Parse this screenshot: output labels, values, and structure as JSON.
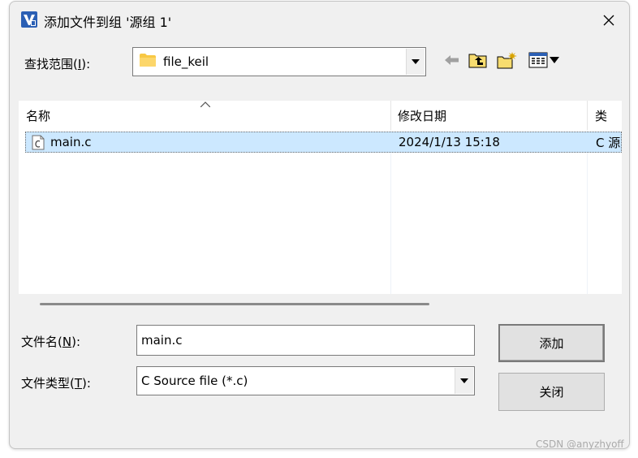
{
  "title": "添加文件到组 '源组 1'",
  "lookin": {
    "label_prefix": "查找范围(",
    "label_key": "I",
    "label_suffix": "):",
    "value": "file_keil"
  },
  "list": {
    "columns": [
      "名称",
      "修改日期",
      "类"
    ],
    "rows": [
      {
        "name": "main.c",
        "modified": "2024/1/13 15:18",
        "type": "C 源"
      }
    ]
  },
  "filename": {
    "label_prefix": "文件名(",
    "label_key": "N",
    "label_suffix": "):",
    "value": "main.c"
  },
  "filetype": {
    "label_prefix": "文件类型(",
    "label_key": "T",
    "label_suffix": "):",
    "value": "C Source file (*.c)"
  },
  "buttons": {
    "add": "添加",
    "close": "关闭"
  },
  "watermark": "CSDN @anyzhyoff",
  "colors": {
    "dialog_bg": "#f0f0f0",
    "selection": "#cce8ff",
    "folder": "#f8c844"
  }
}
